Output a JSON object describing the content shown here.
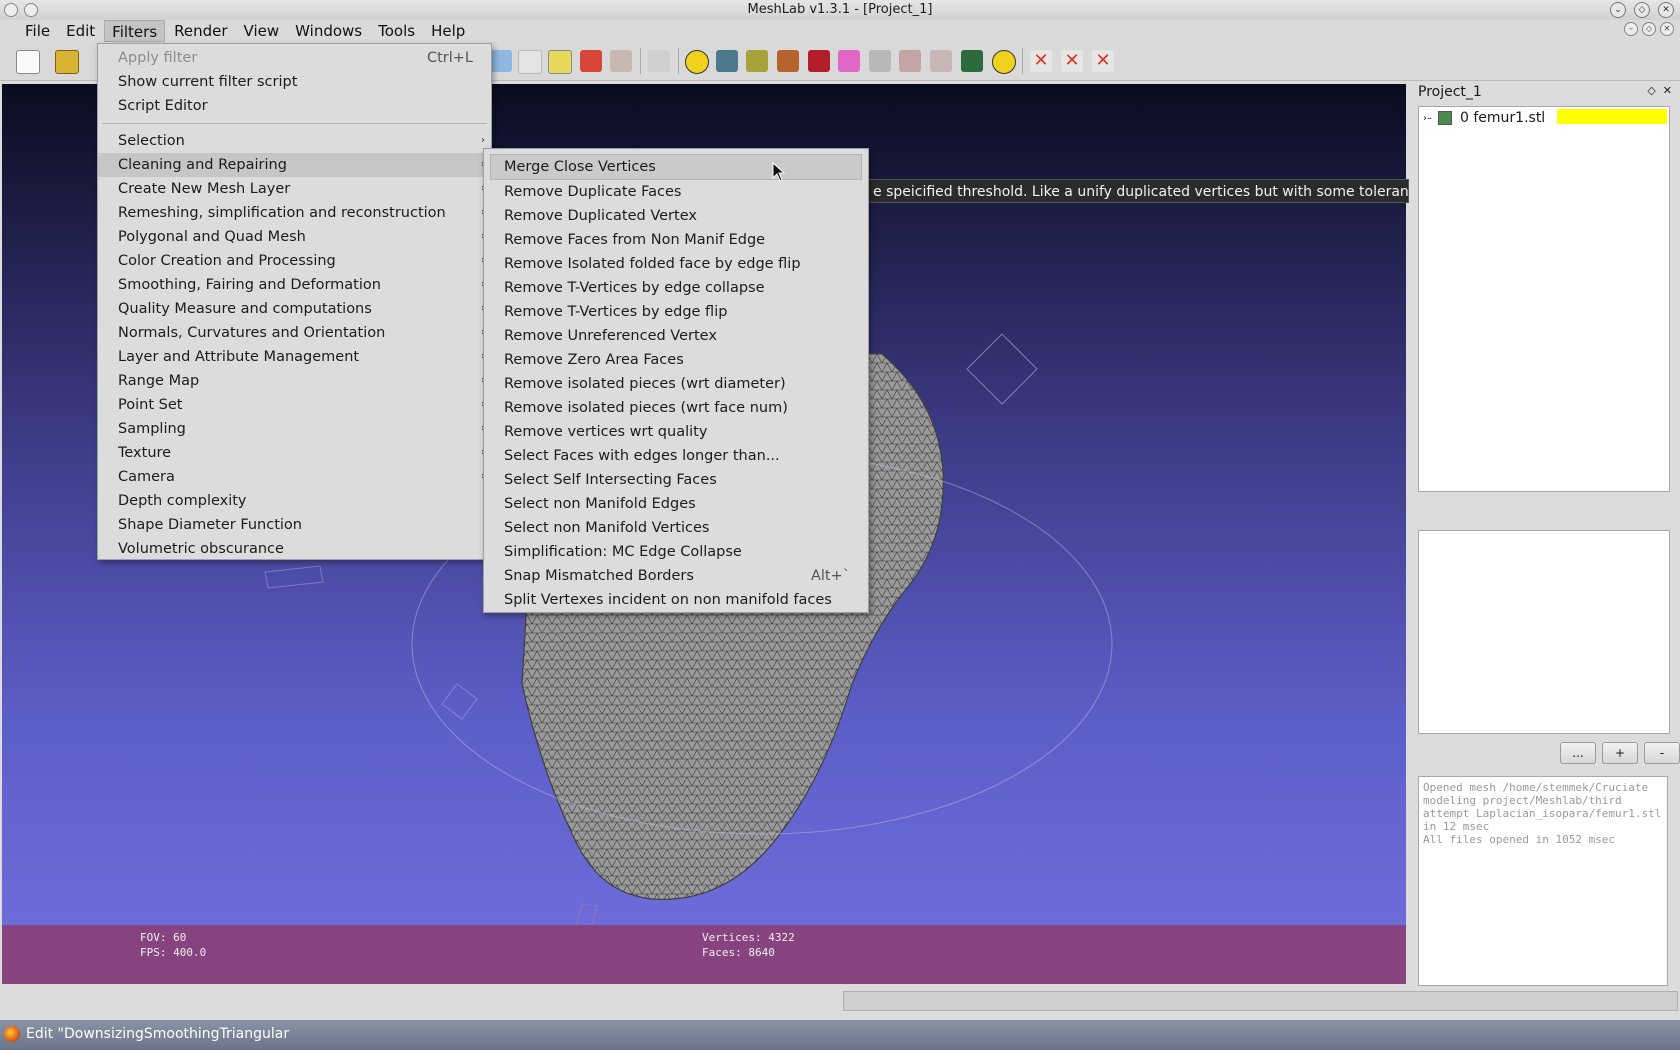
{
  "window": {
    "title": "MeshLab v1.3.1 - [Project_1]"
  },
  "menubar": [
    "File",
    "Edit",
    "Filters",
    "Render",
    "View",
    "Windows",
    "Tools",
    "Help"
  ],
  "filters_menu": {
    "top_items": [
      {
        "label": "Apply filter",
        "shortcut": "Ctrl+L"
      },
      {
        "label": "Show current filter script"
      },
      {
        "label": "Script Editor"
      }
    ],
    "categories": [
      "Selection",
      "Cleaning and Repairing",
      "Create New Mesh Layer",
      "Remeshing, simplification and reconstruction",
      "Polygonal and Quad Mesh",
      "Color Creation and Processing",
      "Smoothing, Fairing and Deformation",
      "Quality Measure and computations",
      "Normals, Curvatures and Orientation",
      "Layer and Attribute Management",
      "Range Map",
      "Point Set",
      "Sampling",
      "Texture",
      "Camera"
    ],
    "plain_items": [
      "Depth complexity",
      "Shape Diameter Function",
      "Volumetric obscurance"
    ]
  },
  "cleaning_submenu": [
    "Merge Close Vertices",
    "Remove Duplicate Faces",
    "Remove Duplicated Vertex",
    "Remove Faces from Non Manif Edge",
    "Remove Isolated folded face by edge flip",
    "Remove T-Vertices by edge collapse",
    "Remove T-Vertices by edge flip",
    "Remove Unreferenced Vertex",
    "Remove Zero Area Faces",
    "Remove isolated pieces (wrt diameter)",
    "Remove isolated pieces (wrt face num)",
    "Remove vertices wrt quality",
    "Select Faces with edges longer than...",
    "Select Self Intersecting Faces",
    "Select non Manifold Edges",
    "Select non Manifold Vertices",
    "Simplification: MC Edge Collapse",
    "Snap Mismatched Borders",
    "Split Vertexes incident on non manifold faces"
  ],
  "snap_shortcut": "Alt+`",
  "tooltip": "e speicified threshold. Like a unify duplicated vertices but with some tolerance.",
  "viewport_info": {
    "fov": "FOV: 60",
    "fps": "FPS:  400.0",
    "vertices": "Vertices: 4322",
    "faces": "Faces: 8640"
  },
  "project_panel": {
    "title": "Project_1",
    "layer": "0  femur1.stl",
    "buttons": [
      "...",
      "+",
      "-"
    ],
    "log": "Opened mesh /home/stemmek/Cruciate modeling project/Meshlab/third attempt Laplacian_isopara/femur1.stl in 12 msec\nAll files opened in 1052 msec"
  },
  "taskbar": {
    "item": "Edit \"DownsizingSmoothingTriangular"
  },
  "colors": {
    "viewport_top": "#0b0b1f",
    "viewport_bottom": "#7070df",
    "info_bar": "#8c3c6e",
    "layer_highlight": "#ffff00"
  }
}
